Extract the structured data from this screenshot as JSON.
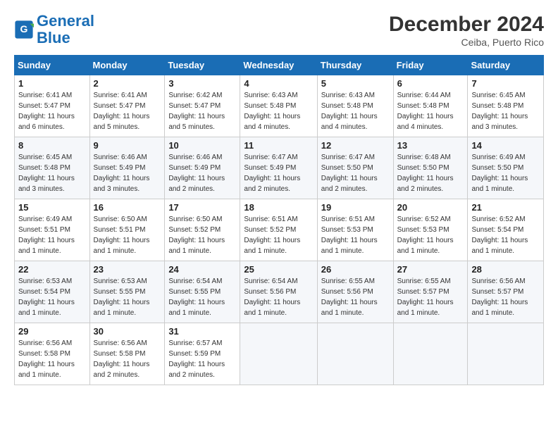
{
  "header": {
    "logo_line1": "General",
    "logo_line2": "Blue",
    "month_title": "December 2024",
    "location": "Ceiba, Puerto Rico"
  },
  "weekdays": [
    "Sunday",
    "Monday",
    "Tuesday",
    "Wednesday",
    "Thursday",
    "Friday",
    "Saturday"
  ],
  "weeks": [
    [
      {
        "day": "1",
        "sunrise": "Sunrise: 6:41 AM",
        "sunset": "Sunset: 5:47 PM",
        "daylight": "Daylight: 11 hours and 6 minutes."
      },
      {
        "day": "2",
        "sunrise": "Sunrise: 6:41 AM",
        "sunset": "Sunset: 5:47 PM",
        "daylight": "Daylight: 11 hours and 5 minutes."
      },
      {
        "day": "3",
        "sunrise": "Sunrise: 6:42 AM",
        "sunset": "Sunset: 5:47 PM",
        "daylight": "Daylight: 11 hours and 5 minutes."
      },
      {
        "day": "4",
        "sunrise": "Sunrise: 6:43 AM",
        "sunset": "Sunset: 5:48 PM",
        "daylight": "Daylight: 11 hours and 4 minutes."
      },
      {
        "day": "5",
        "sunrise": "Sunrise: 6:43 AM",
        "sunset": "Sunset: 5:48 PM",
        "daylight": "Daylight: 11 hours and 4 minutes."
      },
      {
        "day": "6",
        "sunrise": "Sunrise: 6:44 AM",
        "sunset": "Sunset: 5:48 PM",
        "daylight": "Daylight: 11 hours and 4 minutes."
      },
      {
        "day": "7",
        "sunrise": "Sunrise: 6:45 AM",
        "sunset": "Sunset: 5:48 PM",
        "daylight": "Daylight: 11 hours and 3 minutes."
      }
    ],
    [
      {
        "day": "8",
        "sunrise": "Sunrise: 6:45 AM",
        "sunset": "Sunset: 5:48 PM",
        "daylight": "Daylight: 11 hours and 3 minutes."
      },
      {
        "day": "9",
        "sunrise": "Sunrise: 6:46 AM",
        "sunset": "Sunset: 5:49 PM",
        "daylight": "Daylight: 11 hours and 3 minutes."
      },
      {
        "day": "10",
        "sunrise": "Sunrise: 6:46 AM",
        "sunset": "Sunset: 5:49 PM",
        "daylight": "Daylight: 11 hours and 2 minutes."
      },
      {
        "day": "11",
        "sunrise": "Sunrise: 6:47 AM",
        "sunset": "Sunset: 5:49 PM",
        "daylight": "Daylight: 11 hours and 2 minutes."
      },
      {
        "day": "12",
        "sunrise": "Sunrise: 6:47 AM",
        "sunset": "Sunset: 5:50 PM",
        "daylight": "Daylight: 11 hours and 2 minutes."
      },
      {
        "day": "13",
        "sunrise": "Sunrise: 6:48 AM",
        "sunset": "Sunset: 5:50 PM",
        "daylight": "Daylight: 11 hours and 2 minutes."
      },
      {
        "day": "14",
        "sunrise": "Sunrise: 6:49 AM",
        "sunset": "Sunset: 5:50 PM",
        "daylight": "Daylight: 11 hours and 1 minute."
      }
    ],
    [
      {
        "day": "15",
        "sunrise": "Sunrise: 6:49 AM",
        "sunset": "Sunset: 5:51 PM",
        "daylight": "Daylight: 11 hours and 1 minute."
      },
      {
        "day": "16",
        "sunrise": "Sunrise: 6:50 AM",
        "sunset": "Sunset: 5:51 PM",
        "daylight": "Daylight: 11 hours and 1 minute."
      },
      {
        "day": "17",
        "sunrise": "Sunrise: 6:50 AM",
        "sunset": "Sunset: 5:52 PM",
        "daylight": "Daylight: 11 hours and 1 minute."
      },
      {
        "day": "18",
        "sunrise": "Sunrise: 6:51 AM",
        "sunset": "Sunset: 5:52 PM",
        "daylight": "Daylight: 11 hours and 1 minute."
      },
      {
        "day": "19",
        "sunrise": "Sunrise: 6:51 AM",
        "sunset": "Sunset: 5:53 PM",
        "daylight": "Daylight: 11 hours and 1 minute."
      },
      {
        "day": "20",
        "sunrise": "Sunrise: 6:52 AM",
        "sunset": "Sunset: 5:53 PM",
        "daylight": "Daylight: 11 hours and 1 minute."
      },
      {
        "day": "21",
        "sunrise": "Sunrise: 6:52 AM",
        "sunset": "Sunset: 5:54 PM",
        "daylight": "Daylight: 11 hours and 1 minute."
      }
    ],
    [
      {
        "day": "22",
        "sunrise": "Sunrise: 6:53 AM",
        "sunset": "Sunset: 5:54 PM",
        "daylight": "Daylight: 11 hours and 1 minute."
      },
      {
        "day": "23",
        "sunrise": "Sunrise: 6:53 AM",
        "sunset": "Sunset: 5:55 PM",
        "daylight": "Daylight: 11 hours and 1 minute."
      },
      {
        "day": "24",
        "sunrise": "Sunrise: 6:54 AM",
        "sunset": "Sunset: 5:55 PM",
        "daylight": "Daylight: 11 hours and 1 minute."
      },
      {
        "day": "25",
        "sunrise": "Sunrise: 6:54 AM",
        "sunset": "Sunset: 5:56 PM",
        "daylight": "Daylight: 11 hours and 1 minute."
      },
      {
        "day": "26",
        "sunrise": "Sunrise: 6:55 AM",
        "sunset": "Sunset: 5:56 PM",
        "daylight": "Daylight: 11 hours and 1 minute."
      },
      {
        "day": "27",
        "sunrise": "Sunrise: 6:55 AM",
        "sunset": "Sunset: 5:57 PM",
        "daylight": "Daylight: 11 hours and 1 minute."
      },
      {
        "day": "28",
        "sunrise": "Sunrise: 6:56 AM",
        "sunset": "Sunset: 5:57 PM",
        "daylight": "Daylight: 11 hours and 1 minute."
      }
    ],
    [
      {
        "day": "29",
        "sunrise": "Sunrise: 6:56 AM",
        "sunset": "Sunset: 5:58 PM",
        "daylight": "Daylight: 11 hours and 1 minute."
      },
      {
        "day": "30",
        "sunrise": "Sunrise: 6:56 AM",
        "sunset": "Sunset: 5:58 PM",
        "daylight": "Daylight: 11 hours and 2 minutes."
      },
      {
        "day": "31",
        "sunrise": "Sunrise: 6:57 AM",
        "sunset": "Sunset: 5:59 PM",
        "daylight": "Daylight: 11 hours and 2 minutes."
      },
      null,
      null,
      null,
      null
    ]
  ]
}
